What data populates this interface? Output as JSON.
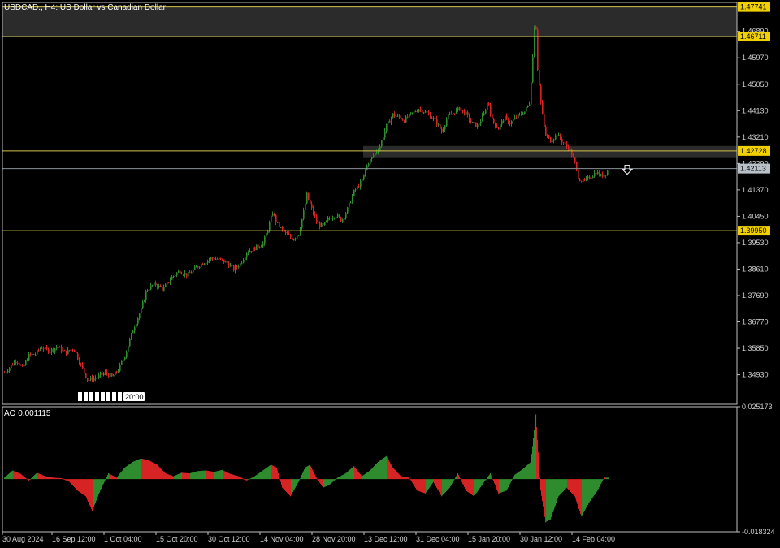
{
  "header": {
    "title": "USDCAD., H4:  US Dollar vs Canadian Dollar"
  },
  "indicator": {
    "label": "AO 0.001115"
  },
  "colors": {
    "background": "#000000",
    "frame": "#c0c0c0",
    "bull_candle": "#2e8b2e",
    "bear_candle": "#d62424",
    "level_line": "#d4c44a",
    "level_label_bg": "#f0d000",
    "current_price_bg": "#b8c0c8",
    "zone_fill": "#2b2b2b"
  },
  "chart_data": [
    {
      "type": "candlestick",
      "title": "USDCAD., H4:  US Dollar vs Canadian Dollar",
      "ylim": [
        1.339,
        1.479
      ],
      "price_ticks": [
        "1.34930",
        "1.35850",
        "1.36770",
        "1.37690",
        "1.38610",
        "1.39530",
        "1.40450",
        "1.41370",
        "1.42290",
        "1.43210",
        "1.44130",
        "1.45050",
        "1.45970",
        "1.46890"
      ],
      "x_ticks": [
        "30 Aug 2024",
        "16 Sep 12:00",
        "1 Oct 04:00",
        "15 Oct 20:00",
        "30 Oct 12:00",
        "14 Nov 04:00",
        "28 Nov 20:00",
        "13 Dec 12:00",
        "31 Dec 04:00",
        "15 Jan 20:00",
        "30 Jan 12:00",
        "14 Feb 04:00"
      ],
      "levels": [
        {
          "price": 1.47741,
          "label": "1.47741"
        },
        {
          "price": 1.46711,
          "label": "1.46711"
        },
        {
          "price": 1.42728,
          "label": "1.42728"
        },
        {
          "price": 1.3995,
          "label": "1.39950"
        }
      ],
      "zones": [
        {
          "from": 1.46711,
          "to": 1.47741
        },
        {
          "from": 1.4248,
          "to": 1.429
        }
      ],
      "current_price": {
        "price": 1.42113,
        "label": "1.42113"
      },
      "time_marker": "20:00",
      "series_path": [
        [
          0,
          1.35
        ],
        [
          8,
          1.3525
        ],
        [
          15,
          1.3545
        ],
        [
          22,
          1.3515
        ],
        [
          30,
          1.356
        ],
        [
          38,
          1.3565
        ],
        [
          45,
          1.359
        ],
        [
          55,
          1.3575
        ],
        [
          65,
          1.359
        ],
        [
          75,
          1.357
        ],
        [
          85,
          1.3585
        ],
        [
          95,
          1.352
        ],
        [
          102,
          1.3475
        ],
        [
          110,
          1.348
        ],
        [
          118,
          1.349
        ],
        [
          125,
          1.35
        ],
        [
          132,
          1.3485
        ],
        [
          140,
          1.351
        ],
        [
          148,
          1.356
        ],
        [
          158,
          1.365
        ],
        [
          168,
          1.372
        ],
        [
          175,
          1.379
        ],
        [
          185,
          1.381
        ],
        [
          195,
          1.379
        ],
        [
          205,
          1.383
        ],
        [
          215,
          1.3855
        ],
        [
          225,
          1.384
        ],
        [
          235,
          1.3865
        ],
        [
          245,
          1.3885
        ],
        [
          255,
          1.39
        ],
        [
          265,
          1.3895
        ],
        [
          275,
          1.388
        ],
        [
          282,
          1.386
        ],
        [
          290,
          1.388
        ],
        [
          298,
          1.392
        ],
        [
          308,
          1.3935
        ],
        [
          318,
          1.395
        ],
        [
          325,
          1.401
        ],
        [
          330,
          1.406
        ],
        [
          335,
          1.402
        ],
        [
          345,
          1.3985
        ],
        [
          355,
          1.3965
        ],
        [
          362,
          1.3985
        ],
        [
          368,
          1.406
        ],
        [
          372,
          1.412
        ],
        [
          378,
          1.407
        ],
        [
          385,
          1.402
        ],
        [
          392,
          1.401
        ],
        [
          400,
          1.404
        ],
        [
          408,
          1.405
        ],
        [
          415,
          1.403
        ],
        [
          422,
          1.407
        ],
        [
          430,
          1.413
        ],
        [
          440,
          1.417
        ],
        [
          447,
          1.423
        ],
        [
          455,
          1.426
        ],
        [
          462,
          1.429
        ],
        [
          470,
          1.436
        ],
        [
          478,
          1.44
        ],
        [
          485,
          1.439
        ],
        [
          492,
          1.438
        ],
        [
          500,
          1.44
        ],
        [
          510,
          1.442
        ],
        [
          520,
          1.4405
        ],
        [
          530,
          1.438
        ],
        [
          538,
          1.434
        ],
        [
          545,
          1.439
        ],
        [
          552,
          1.4405
        ],
        [
          560,
          1.442
        ],
        [
          568,
          1.44
        ],
        [
          575,
          1.437
        ],
        [
          582,
          1.436
        ],
        [
          590,
          1.44
        ],
        [
          595,
          1.445
        ],
        [
          600,
          1.438
        ],
        [
          608,
          1.435
        ],
        [
          615,
          1.439
        ],
        [
          622,
          1.437
        ],
        [
          630,
          1.439
        ],
        [
          640,
          1.441
        ],
        [
          646,
          1.444
        ],
        [
          650,
          1.46
        ],
        [
          653,
          1.477
        ],
        [
          656,
          1.456
        ],
        [
          660,
          1.444
        ],
        [
          665,
          1.433
        ],
        [
          672,
          1.431
        ],
        [
          680,
          1.433
        ],
        [
          688,
          1.43
        ],
        [
          695,
          1.428
        ],
        [
          702,
          1.423
        ],
        [
          706,
          1.418
        ],
        [
          712,
          1.4165
        ],
        [
          720,
          1.418
        ],
        [
          728,
          1.42
        ],
        [
          734,
          1.4185
        ],
        [
          740,
          1.4195
        ],
        [
          744,
          1.4211
        ]
      ],
      "ao_ylim": [
        -0.018324,
        0.025173
      ],
      "ao_ticks": [
        "0.025173",
        "-0.018324"
      ],
      "ao_path": [
        [
          0,
          0.0005
        ],
        [
          10,
          0.003
        ],
        [
          20,
          0.0018
        ],
        [
          30,
          -0.0005
        ],
        [
          40,
          0.0022
        ],
        [
          50,
          0.001
        ],
        [
          60,
          0.0005
        ],
        [
          70,
          0.0003
        ],
        [
          80,
          -0.001
        ],
        [
          90,
          -0.004
        ],
        [
          100,
          -0.006
        ],
        [
          108,
          -0.011
        ],
        [
          118,
          -0.004
        ],
        [
          128,
          0.002
        ],
        [
          138,
          0.0005
        ],
        [
          148,
          0.004
        ],
        [
          158,
          0.006
        ],
        [
          168,
          0.0072
        ],
        [
          178,
          0.0065
        ],
        [
          188,
          0.005
        ],
        [
          198,
          0.002
        ],
        [
          208,
          0.001
        ],
        [
          218,
          0.0022
        ],
        [
          228,
          0.002
        ],
        [
          238,
          0.0028
        ],
        [
          248,
          0.003
        ],
        [
          258,
          0.0025
        ],
        [
          268,
          0.0032
        ],
        [
          278,
          0.0018
        ],
        [
          288,
          0.001
        ],
        [
          298,
          -0.0005
        ],
        [
          308,
          0.001
        ],
        [
          318,
          0.003
        ],
        [
          328,
          0.005
        ],
        [
          335,
          0.004
        ],
        [
          342,
          -0.003
        ],
        [
          352,
          -0.006
        ],
        [
          362,
          -0.001
        ],
        [
          370,
          0.004
        ],
        [
          376,
          0.005
        ],
        [
          384,
          0.0005
        ],
        [
          392,
          -0.003
        ],
        [
          400,
          -0.002
        ],
        [
          410,
          0.0005
        ],
        [
          420,
          0.002
        ],
        [
          430,
          0.0045
        ],
        [
          440,
          0.001
        ],
        [
          450,
          0.003
        ],
        [
          460,
          0.006
        ],
        [
          470,
          0.008
        ],
        [
          478,
          0.004
        ],
        [
          488,
          0.001
        ],
        [
          498,
          0.0005
        ],
        [
          508,
          -0.004
        ],
        [
          518,
          -0.005
        ],
        [
          528,
          -0.001
        ],
        [
          538,
          -0.006
        ],
        [
          548,
          -0.003
        ],
        [
          558,
          0.002
        ],
        [
          568,
          -0.004
        ],
        [
          578,
          -0.006
        ],
        [
          588,
          -0.002
        ],
        [
          598,
          0.002
        ],
        [
          608,
          -0.005
        ],
        [
          618,
          -0.004
        ],
        [
          628,
          0.0015
        ],
        [
          638,
          0.0035
        ],
        [
          648,
          0.006
        ],
        [
          654,
          0.0225
        ],
        [
          660,
          -0.004
        ],
        [
          666,
          -0.015
        ],
        [
          672,
          -0.014
        ],
        [
          682,
          -0.006
        ],
        [
          692,
          -0.003
        ],
        [
          702,
          -0.006
        ],
        [
          710,
          -0.013
        ],
        [
          720,
          -0.008
        ],
        [
          730,
          -0.004
        ],
        [
          738,
          0.0005
        ],
        [
          744,
          0.0005
        ]
      ]
    }
  ]
}
